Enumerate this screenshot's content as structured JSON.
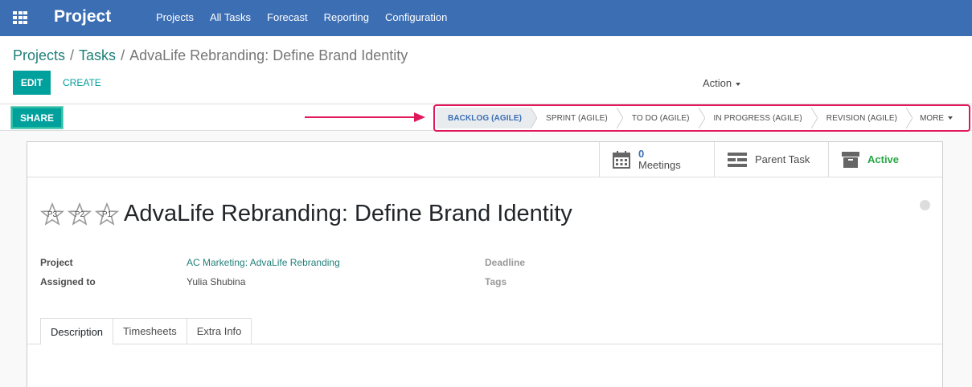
{
  "navbar": {
    "app_title": "Project",
    "menu": [
      "Projects",
      "All Tasks",
      "Forecast",
      "Reporting",
      "Configuration"
    ]
  },
  "breadcrumb": {
    "items": [
      "Projects",
      "Tasks"
    ],
    "separator": "/",
    "current": "AdvaLife Rebranding: Define Brand Identity"
  },
  "toolbar": {
    "edit_label": "EDIT",
    "create_label": "CREATE",
    "action_label": "Action",
    "share_label": "SHARE"
  },
  "stages": {
    "items": [
      "BACKLOG (AGILE)",
      "SPRINT (AGILE)",
      "TO DO (AGILE)",
      "IN PROGRESS (AGILE)",
      "REVISION (AGILE)"
    ],
    "active_index": 0,
    "more_label": "MORE"
  },
  "smart_buttons": {
    "meetings_count": "0",
    "meetings_label": "Meetings",
    "parent_label": "Parent Task",
    "active_label": "Active"
  },
  "task": {
    "priority_stars": [
      "P3",
      "P2",
      "P1"
    ],
    "title": "AdvaLife Rebranding: Define Brand Identity"
  },
  "fields": {
    "project_label": "Project",
    "project_value": "AC Marketing: AdvaLife Rebranding",
    "assigned_label": "Assigned to",
    "assigned_value": "Yulia Shubina",
    "deadline_label": "Deadline",
    "tags_label": "Tags"
  },
  "tabs": [
    "Description",
    "Timesheets",
    "Extra Info"
  ],
  "colors": {
    "navbar": "#3c6eb4",
    "primary_button": "#00a09d",
    "highlight_box": "#e0185a",
    "active_status": "#28a745"
  }
}
